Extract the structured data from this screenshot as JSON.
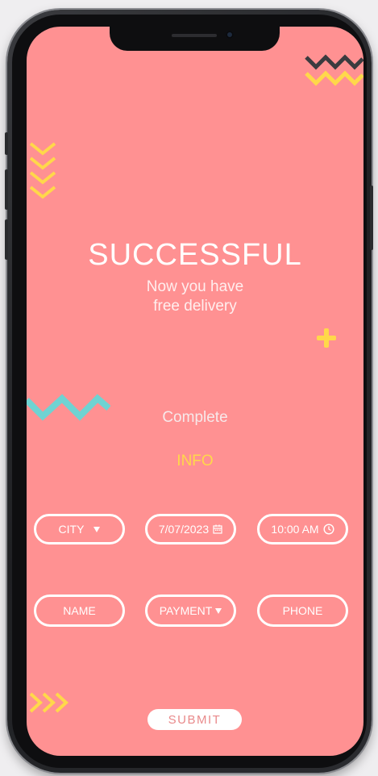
{
  "colors": {
    "background": "#ff9192",
    "accent_yellow": "#ffd84a",
    "accent_teal": "#6fd3d2",
    "accent_dark": "#3b3b3f",
    "text_light": "#ffffff"
  },
  "header": {
    "title": "SUCCESSFUL",
    "subtitle_line1": "Now you have",
    "subtitle_line2": "free delivery"
  },
  "section": {
    "complete_label": "Complete",
    "info_label": "INFO"
  },
  "form": {
    "city": {
      "value": "CITY",
      "icon": "caret-down-icon"
    },
    "date": {
      "value": "7/07/2023",
      "icon": "calendar-icon"
    },
    "time": {
      "value": "10:00 AM",
      "icon": "clock-icon"
    },
    "name": {
      "value": "NAME"
    },
    "payment": {
      "value": "PAYMENT",
      "icon": "caret-down-icon"
    },
    "phone": {
      "value": "PHONE"
    }
  },
  "actions": {
    "submit_label": "SUBMIT"
  }
}
